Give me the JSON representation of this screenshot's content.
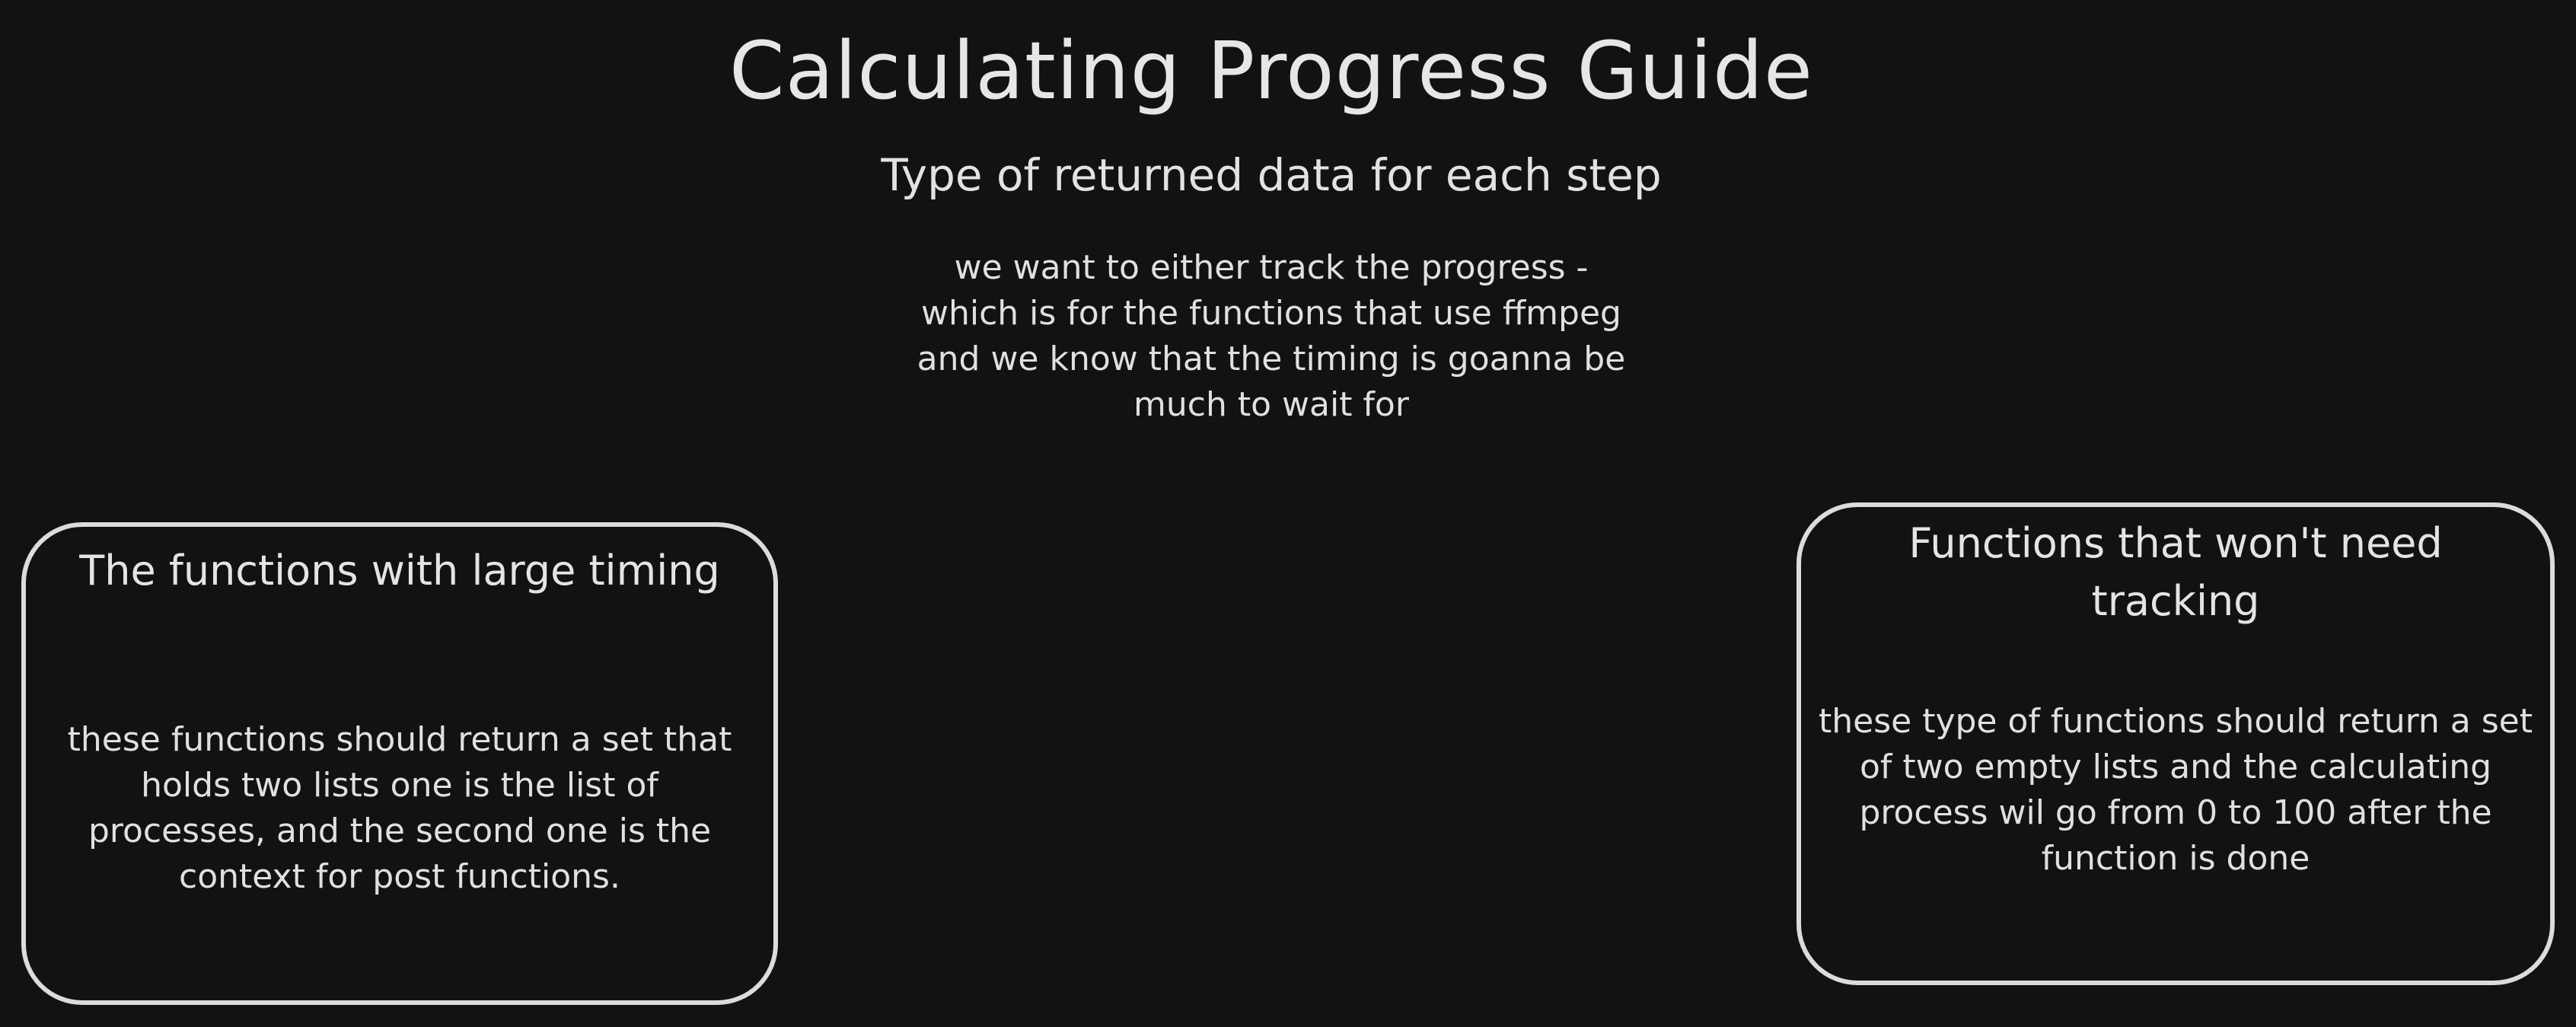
{
  "title": "Calculating Progress Guide",
  "subtitle": "Type of returned data for each step",
  "note": "we want to either track the progress - which is for the functions that use ffmpeg and we know that the timing is goanna be much to wait for",
  "cards": [
    {
      "heading": "The functions with large timing",
      "body": "these functions should return a set that holds two lists one is the list of processes, and the second one is the context for post functions."
    },
    {
      "heading": "Functions that won't need tracking",
      "body": "these type of functions should return a set of two empty lists and the calculating process wil go from 0 to 100 after the function is done"
    }
  ]
}
